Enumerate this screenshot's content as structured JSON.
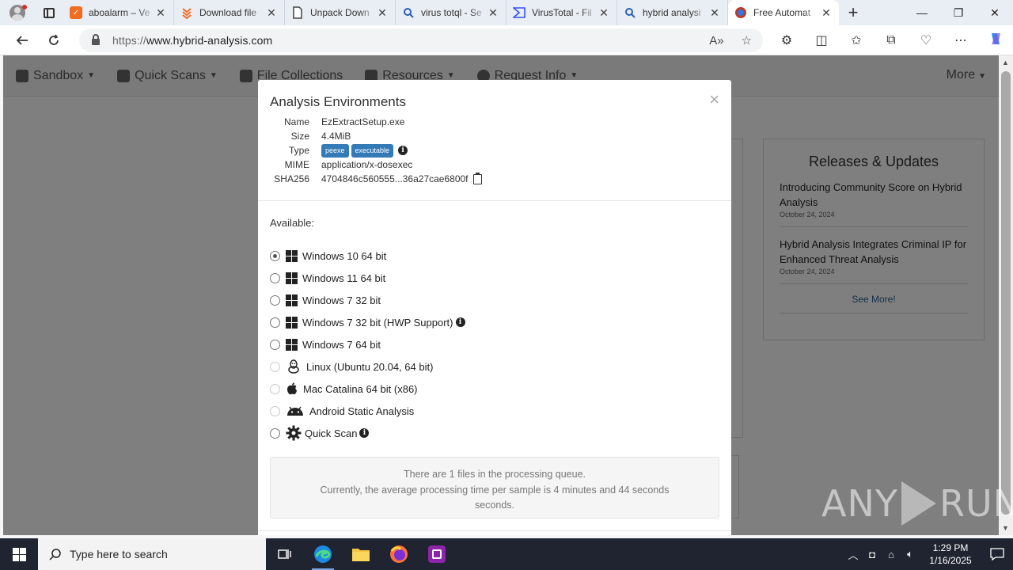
{
  "browser": {
    "tabs": [
      {
        "label": "aboalarm – Ve",
        "icon": "aboalarm-icon",
        "color": "#f26b21"
      },
      {
        "label": "Download file",
        "icon": "download-file-icon",
        "color": "#f26b21"
      },
      {
        "label": "Unpack Down",
        "icon": "document-icon",
        "color": "#ffffff"
      },
      {
        "label": "virus totql - Se",
        "icon": "search-icon",
        "color": "#ffffff"
      },
      {
        "label": "VirusTotal - Fil",
        "icon": "virustotal-icon",
        "color": "#394eff"
      },
      {
        "label": "hybrid analysi",
        "icon": "search-icon",
        "color": "#ffffff"
      },
      {
        "label": "Free Automat",
        "icon": "hybrid-analysis-icon",
        "color": "#ffffff"
      }
    ],
    "url_prefix": "https://",
    "url_host": "www.hybrid-analysis.com"
  },
  "site_nav": {
    "items": [
      "Sandbox",
      "Quick Scans",
      "File Collections",
      "Resources",
      "Request Info"
    ],
    "more": "More"
  },
  "releases": {
    "title": "Releases & Updates",
    "items": [
      {
        "title": "Introducing Community Score on Hybrid Analysis",
        "date": "October 24, 2024"
      },
      {
        "title": "Hybrid Analysis Integrates Criminal IP for Enhanced Threat Analysis",
        "date": "October 24, 2024"
      }
    ],
    "see_more": "See More!"
  },
  "modal": {
    "title": "Analysis Environments",
    "close": "×",
    "file": {
      "name_label": "Name",
      "name": "EzExtractSetup.exe",
      "size_label": "Size",
      "size": "4.4MiB",
      "type_label": "Type",
      "type_badges": [
        "peexe",
        "executable"
      ],
      "mime_label": "MIME",
      "mime": "application/x-dosexec",
      "sha_label": "SHA256",
      "sha256": "4704846c560555...36a27cae6800f"
    },
    "available_label": "Available:",
    "environments": [
      {
        "label": "Windows 10 64 bit",
        "checked": true,
        "disabled": false
      },
      {
        "label": "Windows 11 64 bit",
        "checked": false,
        "disabled": false
      },
      {
        "label": "Windows 7 32 bit",
        "checked": false,
        "disabled": false
      },
      {
        "label": "Windows 7 32 bit (HWP Support)",
        "checked": false,
        "disabled": false
      },
      {
        "label": "Windows 7 64 bit",
        "checked": false,
        "disabled": false
      },
      {
        "label": "Linux (Ubuntu 20.04, 64 bit)",
        "checked": false,
        "disabled": true
      },
      {
        "label": "Mac Catalina 64 bit (x86)",
        "checked": false,
        "disabled": true
      },
      {
        "label": "Android Static Analysis",
        "checked": false,
        "disabled": true
      },
      {
        "label": "Quick Scan",
        "checked": false,
        "disabled": false
      }
    ],
    "queue_line1": "There are 1 files in the processing queue.",
    "queue_line2": "Currently, the average processing time per sample is 4 minutes and 44 seconds",
    "queue_line3": "seconds."
  },
  "watermark": {
    "left": "ANY",
    "right": "RUN"
  },
  "taskbar": {
    "search_placeholder": "Type here to search",
    "time": "1:29 PM",
    "date": "1/16/2025"
  },
  "colors": {
    "accent": "#337ab7",
    "link": "#2a6496",
    "taskbar": "#1f2430"
  }
}
